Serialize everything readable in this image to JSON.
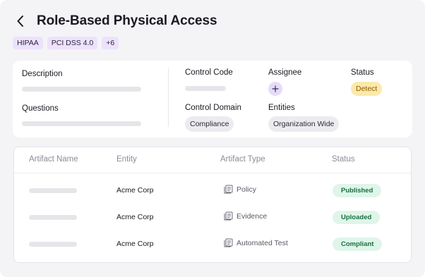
{
  "header": {
    "title": "Role-Based Physical Access",
    "back_icon": "chevron-left-icon"
  },
  "tags": [
    "HIPAA",
    "PCI DSS 4.0",
    "+6"
  ],
  "details": {
    "description_label": "Description",
    "questions_label": "Questions",
    "control_code_label": "Control Code",
    "assignee_label": "Assignee",
    "status_label": "Status",
    "status_value": "Detect",
    "control_domain_label": "Control Domain",
    "control_domain_value": "Compliance",
    "entities_label": "Entities",
    "entities_value": "Organization Wide",
    "assignee_add_icon": "plus-icon"
  },
  "table": {
    "columns": [
      "Artifact Name",
      "Entity",
      "Artifact Type",
      "Status"
    ],
    "rows": [
      {
        "entity": "Acme Corp",
        "type": "Policy",
        "status": "Published"
      },
      {
        "entity": "Acme Corp",
        "type": "Evidence",
        "status": "Uploaded"
      },
      {
        "entity": "Acme Corp",
        "type": "Automated Test",
        "status": "Compliant"
      }
    ],
    "type_icon": "document-icon"
  },
  "colors": {
    "accent_purple": "#e6dbf8",
    "status_detect_bg": "#fbe9a9",
    "status_green_bg": "#e0f5ea",
    "status_green_text": "#17703f"
  }
}
